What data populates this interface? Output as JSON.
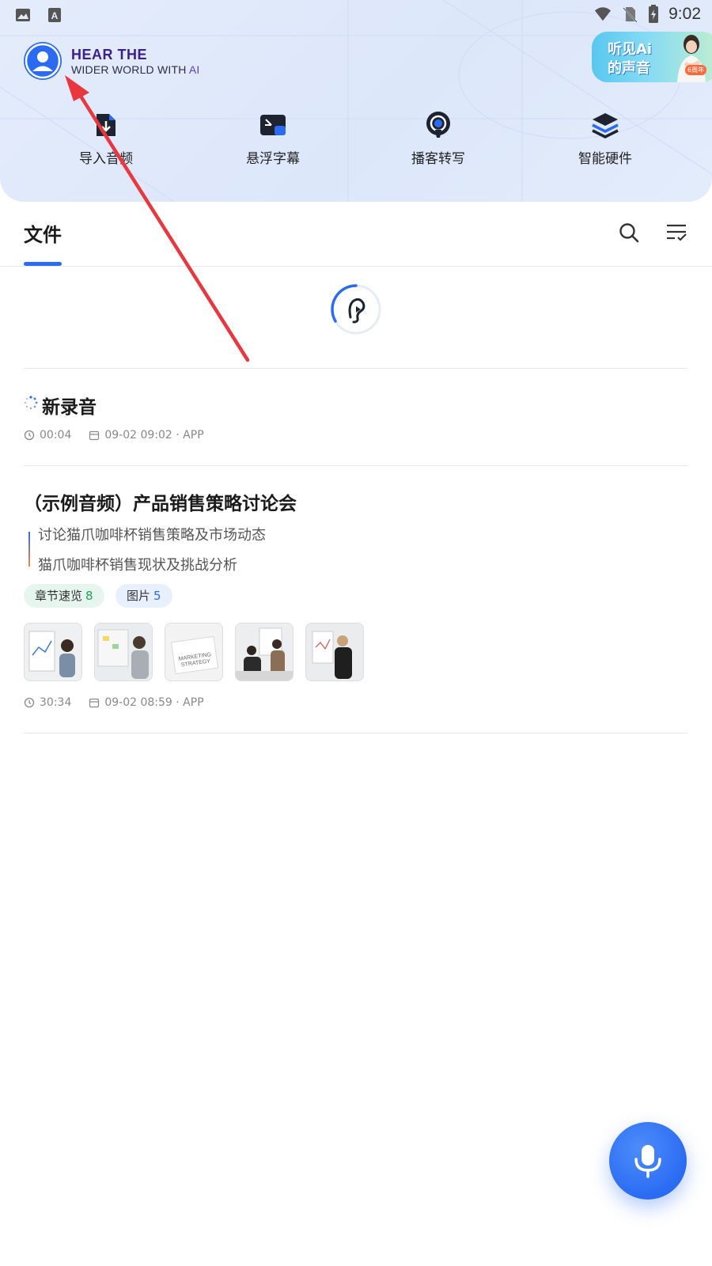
{
  "status_bar": {
    "time": "9:02"
  },
  "brand": {
    "line1": "HEAR THE",
    "line2_prefix": "WIDER WORLD WITH ",
    "line2_ai": "AI"
  },
  "promo": {
    "line1": "听见Ai",
    "line2": "的声音",
    "badge": "6周年"
  },
  "actions": [
    {
      "label": "导入音频",
      "icon": "import-audio-icon"
    },
    {
      "label": "悬浮字幕",
      "icon": "floating-subtitle-icon"
    },
    {
      "label": "播客转写",
      "icon": "podcast-transcribe-icon"
    },
    {
      "label": "智能硬件",
      "icon": "smart-hardware-icon"
    }
  ],
  "tabs": {
    "files": "文件"
  },
  "items": [
    {
      "title": "新录音",
      "duration": "00:04",
      "date": "09-02  09:02 · APP"
    },
    {
      "title": "（示例音频）产品销售策略讨论会",
      "summary": [
        "讨论猫爪咖啡杯销售策略及市场动态",
        "猫爪咖啡杯销售现状及挑战分析"
      ],
      "tags": [
        {
          "label": "章节速览",
          "count": "8"
        },
        {
          "label": "图片",
          "count": "5"
        }
      ],
      "duration": "30:34",
      "date": "09-02  08:59 · APP"
    }
  ],
  "colors": {
    "accent": "#2b6bf3",
    "annotation": "#e8373f"
  }
}
